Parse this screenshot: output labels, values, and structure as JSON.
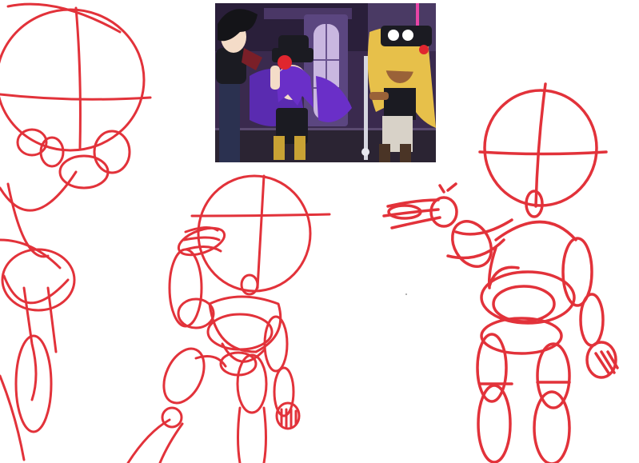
{
  "canvas": {
    "background": "#ffffff"
  },
  "sketch": {
    "stroke_color": "#e2323a"
  },
  "reference_image": {
    "palette": {
      "night_wall": "#3a2a4e",
      "window_glow": "#c9b7e0",
      "floor": "#2b2433",
      "purple_hair": "#6a2fc8",
      "blonde_hair": "#e7c04a",
      "black_clothes": "#1b1b22",
      "accent_red": "#e0262f",
      "skin": "#f4dcc8",
      "tan_skin": "#9a6238",
      "pink_light": "#e845a6"
    }
  },
  "figures": [
    {
      "id": "left-figure",
      "description_name": "cropped-head-and-torso"
    },
    {
      "id": "middle-figure",
      "description_name": "saluting-pose"
    },
    {
      "id": "right-figure",
      "description_name": "reaching-pose"
    }
  ]
}
